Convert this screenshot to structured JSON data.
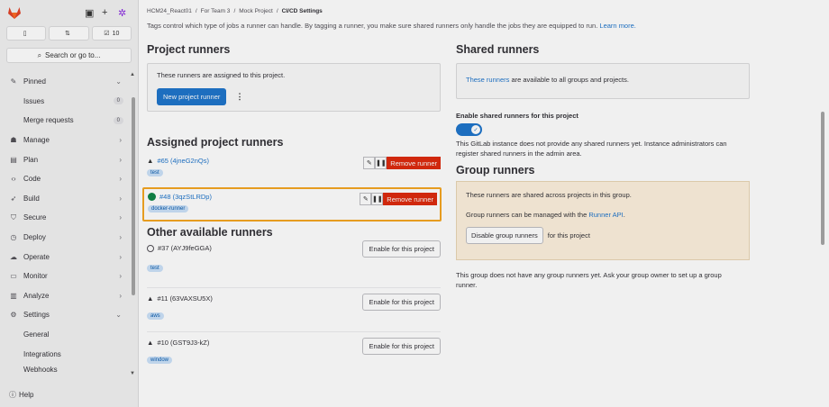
{
  "sidebar": {
    "counters": [
      {
        "icon": "issues-icon",
        "value": ""
      },
      {
        "icon": "merge-request-icon",
        "value": ""
      },
      {
        "icon": "todo-icon",
        "value": "10"
      }
    ],
    "search_label": "Search or go to...",
    "pinned": "Pinned",
    "items": [
      {
        "label": "Issues",
        "badge": "0"
      },
      {
        "label": "Merge requests",
        "badge": "0"
      },
      {
        "label": "Manage"
      },
      {
        "label": "Plan"
      },
      {
        "label": "Code"
      },
      {
        "label": "Build"
      },
      {
        "label": "Secure"
      },
      {
        "label": "Deploy"
      },
      {
        "label": "Operate"
      },
      {
        "label": "Monitor"
      },
      {
        "label": "Analyze"
      },
      {
        "label": "Settings"
      },
      {
        "label": "General"
      },
      {
        "label": "Integrations"
      },
      {
        "label": "Webhooks"
      }
    ],
    "help": "Help"
  },
  "breadcrumb": [
    "HCM24_React01",
    "For Team 3",
    "Mock Project",
    "CI/CD Settings"
  ],
  "intro_text": "Tags control which type of jobs a runner can handle. By tagging a runner, you make sure shared runners only handle the jobs they are equipped to run.",
  "intro_link": "Learn more.",
  "project_runners": {
    "title": "Project runners",
    "desc": "These runners are assigned to this project.",
    "new_button": "New project runner"
  },
  "assigned": {
    "title": "Assigned project runners",
    "runners": [
      {
        "name": "#65 (4jneG2nQs)",
        "tag": "test",
        "status": "warning",
        "remove": "Remove runner"
      },
      {
        "name": "#48 (3qzStLRDp)",
        "tag": "docker-runner",
        "status": "online",
        "remove": "Remove runner"
      }
    ]
  },
  "other": {
    "title": "Other available runners",
    "enable_label": "Enable for this project",
    "runners": [
      {
        "name": "#37 (AYJ9feGGA)",
        "tag": "test",
        "status": "offline"
      },
      {
        "name": "#11 (63VAXSU5X)",
        "tag": "aws",
        "status": "warning"
      },
      {
        "name": "#10 (GST9J3-kZ)",
        "tag": "window",
        "status": "warning"
      }
    ]
  },
  "shared": {
    "title": "Shared runners",
    "link": "These runners",
    "desc": " are available to all groups and projects.",
    "toggle_label": "Enable shared runners for this project",
    "note": "This GitLab instance does not provide any shared runners yet. Instance administrators can register shared runners in the admin area."
  },
  "group": {
    "title": "Group runners",
    "desc": "These runners are shared across projects in this group.",
    "manage_text": "Group runners can be managed with the ",
    "manage_link": "Runner API",
    "manage_end": ".",
    "disable_button": "Disable group runners",
    "disable_suffix": "for this project",
    "note": "This group does not have any group runners yet. Ask your group owner to set up a group runner."
  }
}
